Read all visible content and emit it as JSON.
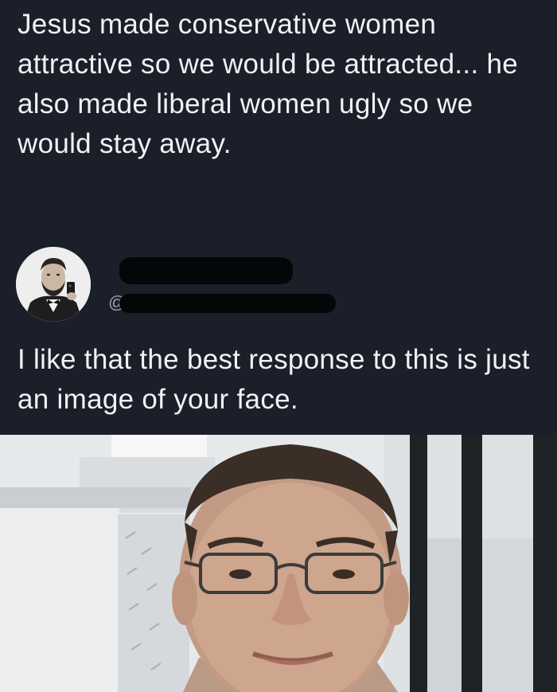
{
  "post": {
    "text": "Jesus made conservative women attractive so we would be attracted... he also made liberal women ugly so we would stay away."
  },
  "reply": {
    "handle_prefix": "@",
    "text": "I like that the best response to this is just an image of your face."
  },
  "colors": {
    "background": "#1b1f2a",
    "text": "#f1f2f4",
    "redaction": "#050608"
  }
}
